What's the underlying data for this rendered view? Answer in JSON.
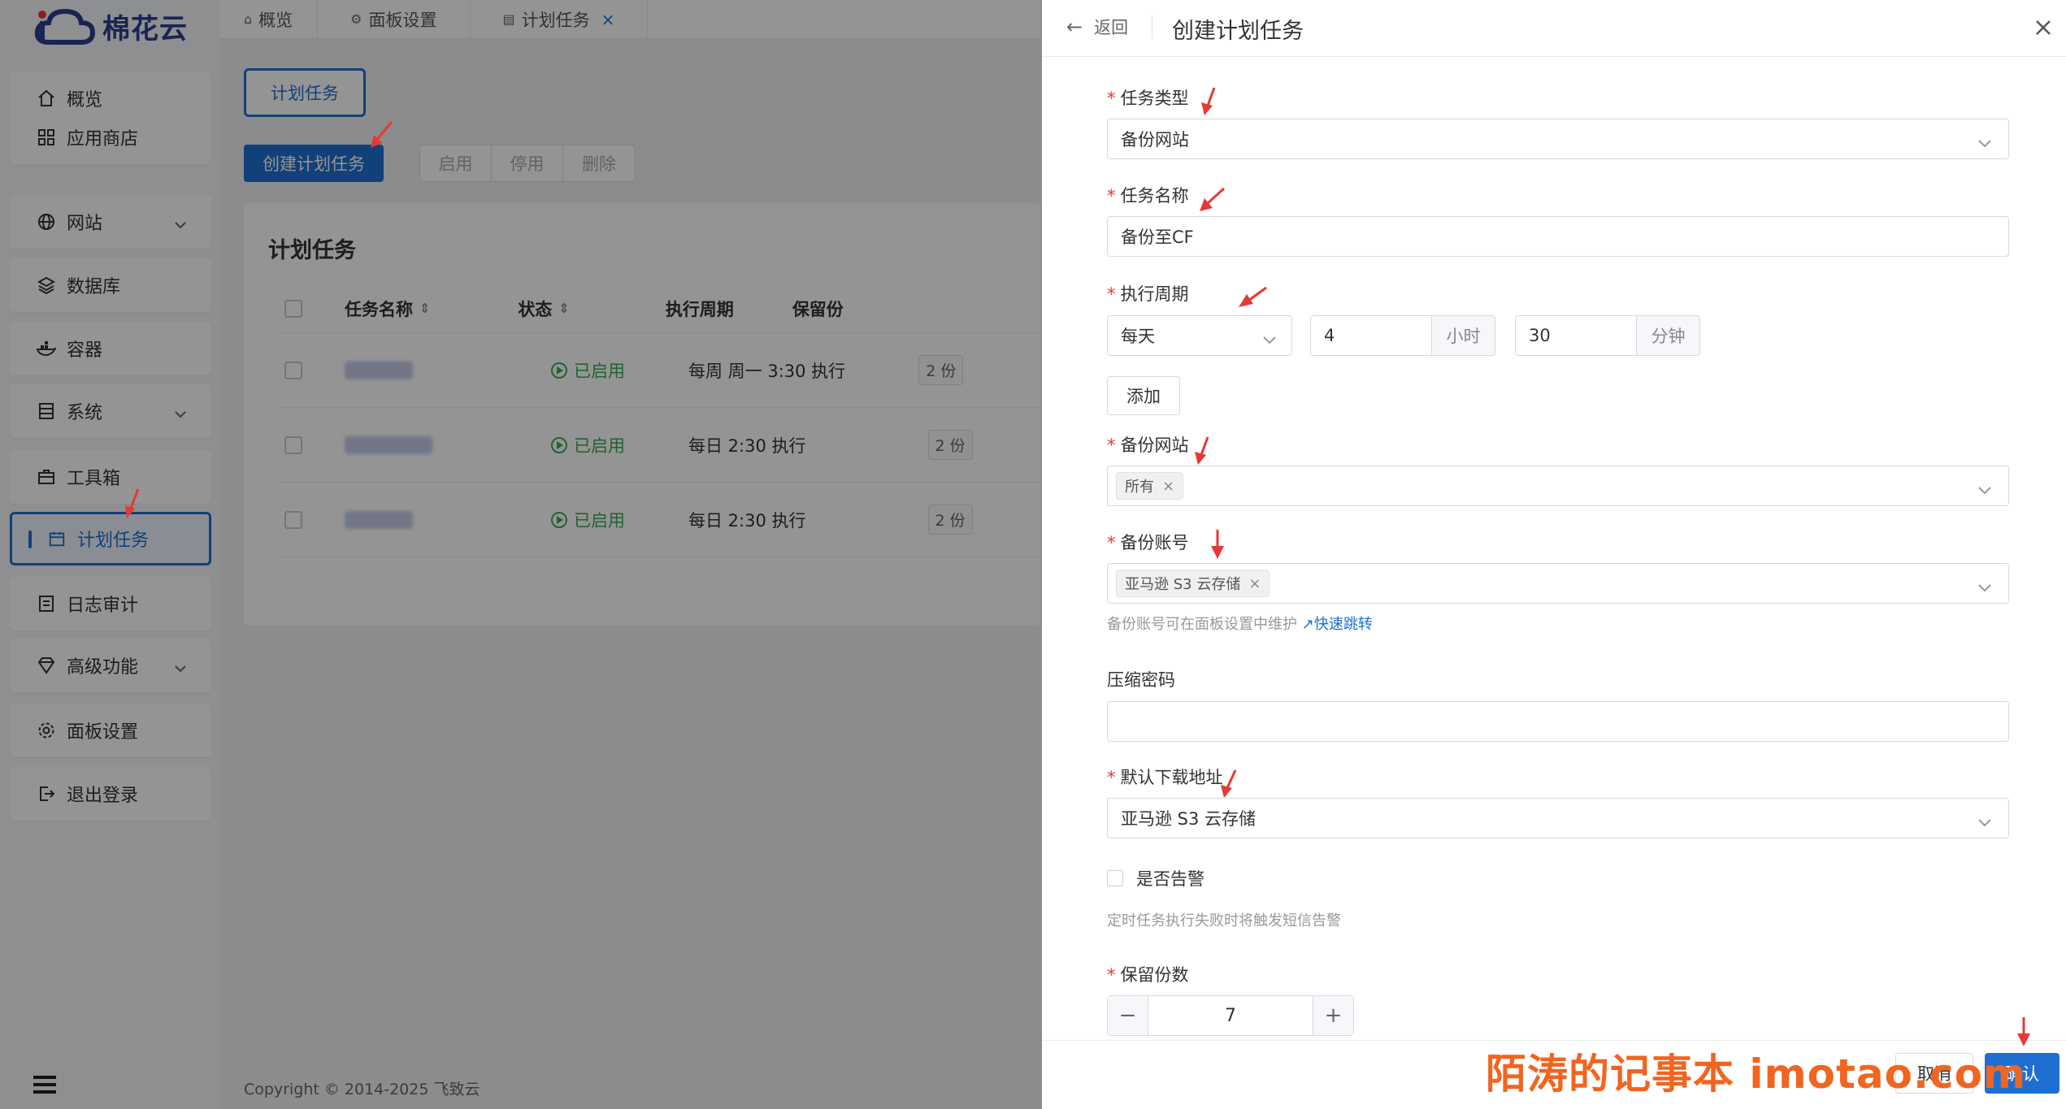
{
  "brand": {
    "name": "棉花云",
    "accent": "#1f6fd1"
  },
  "sidebar": {
    "items": [
      {
        "label": "概览",
        "icon": "home-icon"
      },
      {
        "label": "应用商店",
        "icon": "grid-icon"
      },
      {
        "label": "网站",
        "icon": "globe-icon",
        "expandable": true
      },
      {
        "label": "数据库",
        "icon": "layers-icon"
      },
      {
        "label": "容器",
        "icon": "docker-icon"
      },
      {
        "label": "系统",
        "icon": "server-icon",
        "expandable": true
      },
      {
        "label": "工具箱",
        "icon": "toolbox-icon"
      },
      {
        "label": "计划任务",
        "icon": "calendar-icon",
        "active": true
      },
      {
        "label": "日志审计",
        "icon": "log-icon"
      },
      {
        "label": "高级功能",
        "icon": "diamond-icon",
        "expandable": true
      },
      {
        "label": "面板设置",
        "icon": "gear-icon"
      },
      {
        "label": "退出登录",
        "icon": "logout-icon"
      }
    ]
  },
  "topbar": {
    "tabs": [
      {
        "label": "概览"
      },
      {
        "label": "面板设置"
      },
      {
        "label": "计划任务",
        "closable": true
      }
    ]
  },
  "main": {
    "page_tab": "计划任务",
    "create_button": "创建计划任务",
    "actions": [
      "启用",
      "停用",
      "删除"
    ],
    "card_title": "计划任务",
    "columns": [
      "任务名称",
      "状态",
      "执行周期",
      "保留份"
    ],
    "rows": [
      {
        "status": "已启用",
        "cycle": "每周 周一 3:30 执行",
        "keep": "2 份"
      },
      {
        "status": "已启用",
        "cycle": "每日 2:30 执行",
        "keep": "2 份"
      },
      {
        "status": "已启用",
        "cycle": "每日 2:30 执行",
        "keep": "2 份"
      }
    ],
    "copyright": "Copyright © 2014-2025 飞致云"
  },
  "drawer": {
    "back_label": "返回",
    "title": "创建计划任务",
    "task_type": {
      "label": "任务类型",
      "value": "备份网站"
    },
    "task_name": {
      "label": "任务名称",
      "value": "备份至CF"
    },
    "cycle": {
      "label": "执行周期",
      "period": "每天",
      "hour": "4",
      "hour_unit": "小时",
      "minute": "30",
      "minute_unit": "分钟",
      "add_label": "添加"
    },
    "backup_site": {
      "label": "备份网站",
      "tag": "所有"
    },
    "backup_account": {
      "label": "备份账号",
      "tag": "亚马逊 S3 云存储",
      "hint": "备份账号可在面板设置中维护",
      "hint_link": "快速跳转"
    },
    "zip_password": {
      "label": "压缩密码",
      "value": ""
    },
    "default_download": {
      "label": "默认下载地址",
      "value": "亚马逊 S3 云存储"
    },
    "alert": {
      "label": "是否告警",
      "hint": "定时任务执行失败时将触发短信告警"
    },
    "retain": {
      "label": "保留份数",
      "value": "7"
    },
    "cancel_label": "取消",
    "confirm_label": "确认"
  },
  "watermark": "陌涛的记事本 imotao.com"
}
